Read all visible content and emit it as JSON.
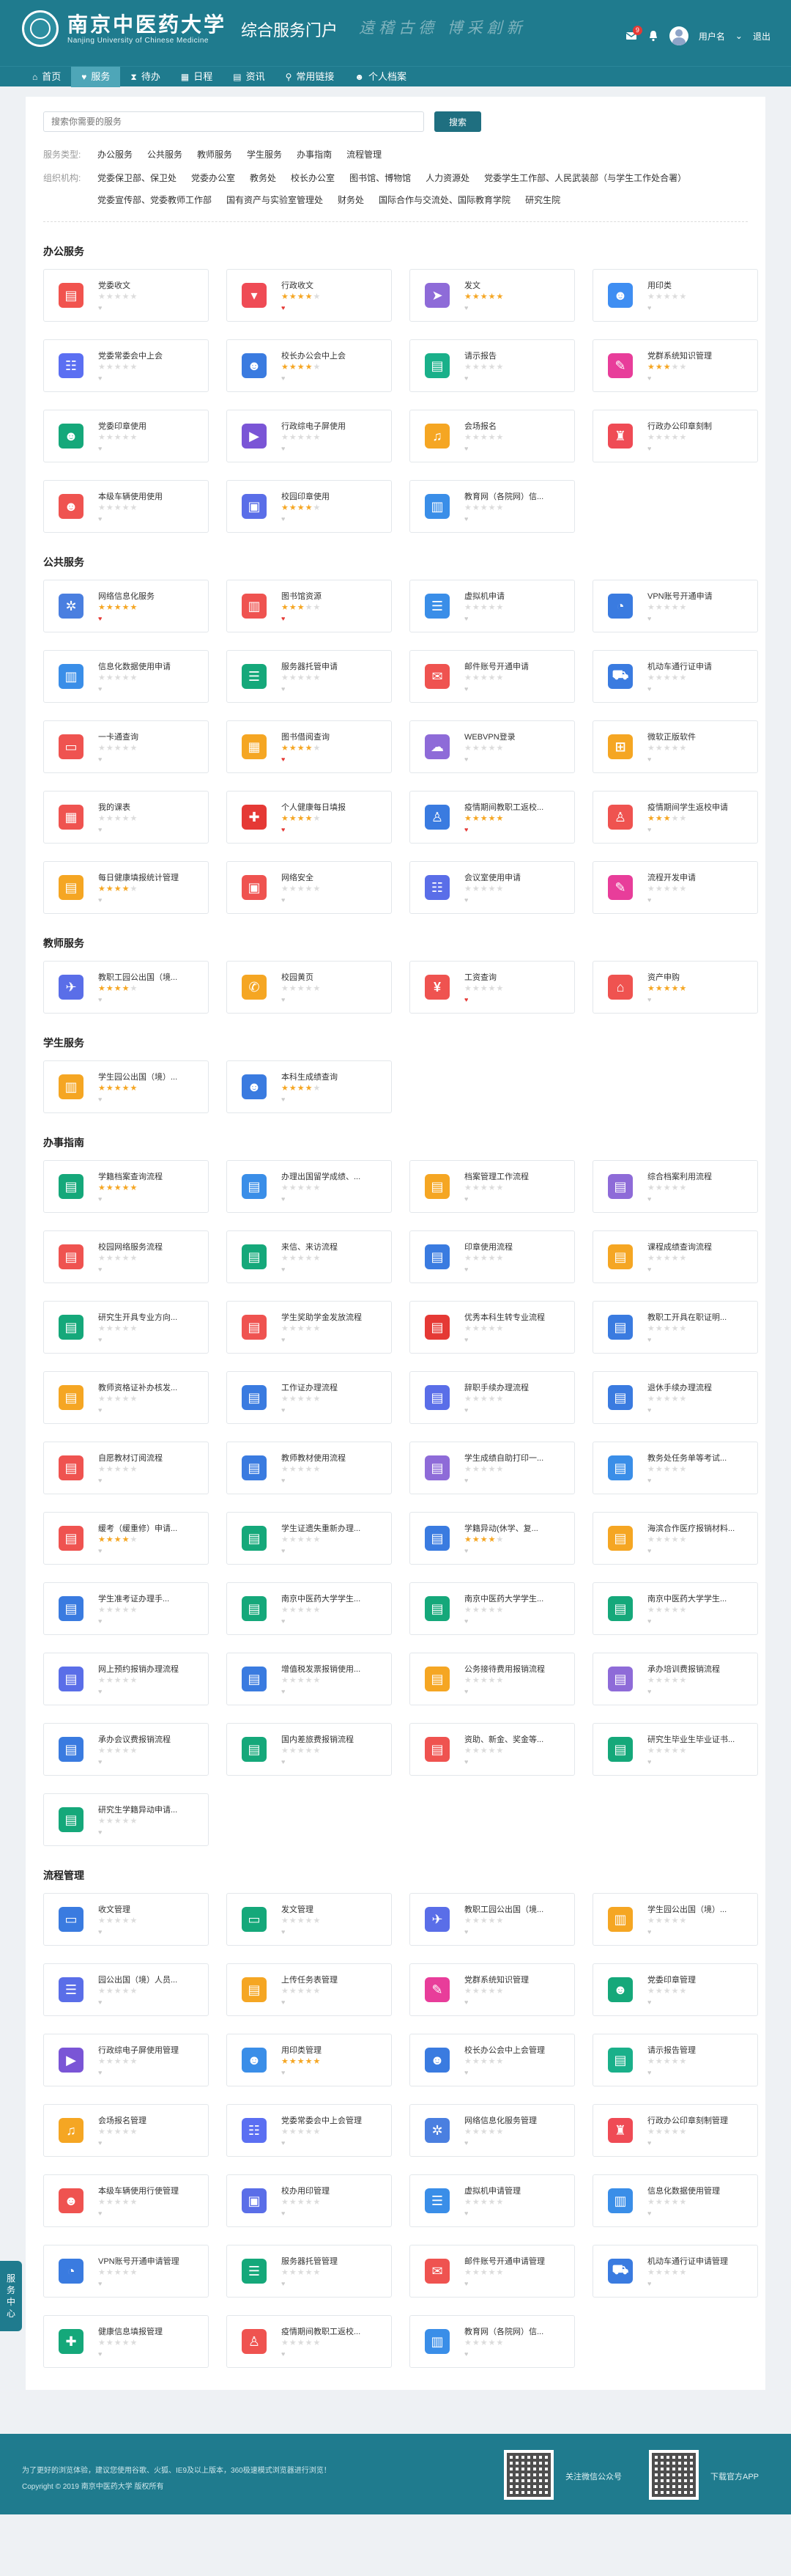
{
  "header": {
    "logo_cn": "南京中医药大学",
    "logo_en": "Nanjing University of Chinese Medicine",
    "portal_title": "综合服务门户",
    "slogan": "遠稽古德 博采創新",
    "user_name": "用户名",
    "logout": "退出",
    "message_badge": "9"
  },
  "nav": [
    "首页",
    "服务",
    "待办",
    "日程",
    "资讯",
    "常用链接",
    "个人档案"
  ],
  "search": {
    "placeholder": "搜索你需要的服务",
    "button": "搜索"
  },
  "filters": {
    "type_label": "服务类型:",
    "types": [
      "办公服务",
      "公共服务",
      "教师服务",
      "学生服务",
      "办事指南",
      "流程管理"
    ],
    "dept_label": "组织机构:",
    "depts": [
      "党委保卫部、保卫处",
      "党委办公室",
      "教务处",
      "校长办公室",
      "图书馆、博物馆",
      "人力资源处",
      "党委学生工作部、人民武装部（与学生工作处合署）",
      "党委宣传部、党委教师工作部",
      "国有资产与实验室管理处",
      "财务处",
      "国际合作与交流处、国际教育学院",
      "研究生院"
    ]
  },
  "sections": [
    {
      "title": "办公服务",
      "items": [
        {
          "name": "党委收文",
          "stars": 0,
          "fav": 0,
          "icon": "doc-icon",
          "color": "#f1534e"
        },
        {
          "name": "行政收文",
          "stars": 4,
          "fav": 1,
          "icon": "inbox-icon",
          "color": "#ef4b55"
        },
        {
          "name": "发文",
          "stars": 5,
          "fav": 0,
          "icon": "send-icon",
          "color": "#8e6bd8"
        },
        {
          "name": "用印类",
          "stars": 0,
          "fav": 0,
          "icon": "user-icon",
          "color": "#3f8ef2"
        },
        {
          "name": "党委常委会中上会",
          "stars": 0,
          "fav": 0,
          "icon": "meeting-icon",
          "color": "#5b6ff2"
        },
        {
          "name": "校长办公会中上会",
          "stars": 4,
          "fav": 0,
          "icon": "person-icon",
          "color": "#3a7be0"
        },
        {
          "name": "请示报告",
          "stars": 0,
          "fav": 0,
          "icon": "report-icon",
          "color": "#1ab08a"
        },
        {
          "name": "党群系统知识管理",
          "stars": 3,
          "fav": 0,
          "icon": "knowledge-icon",
          "color": "#e83d9a"
        },
        {
          "name": "党委印章使用",
          "stars": 0,
          "fav": 0,
          "icon": "seal-icon",
          "color": "#15a87a"
        },
        {
          "name": "行政综电子屏使用",
          "stars": 0,
          "fav": 0,
          "icon": "screen-icon",
          "color": "#7a55d6"
        },
        {
          "name": "会场报名",
          "stars": 0,
          "fav": 0,
          "icon": "bell-icon",
          "color": "#f5a623"
        },
        {
          "name": "行政办公印章刻制",
          "stars": 0,
          "fav": 0,
          "icon": "stamp-icon",
          "color": "#ef4b55"
        },
        {
          "name": "本级车辆使用使用",
          "stars": 0,
          "fav": 0,
          "icon": "car-icon",
          "color": "#ef5350"
        },
        {
          "name": "校园印章使用",
          "stars": 4,
          "fav": 0,
          "icon": "profile-icon",
          "color": "#5a6ee8"
        },
        {
          "name": "教育网（各院网）信...",
          "stars": 0,
          "fav": 0,
          "icon": "chart-icon",
          "color": "#3a8ee8"
        }
      ]
    },
    {
      "title": "公共服务",
      "items": [
        {
          "name": "网络信息化服务",
          "stars": 5,
          "fav": 1,
          "icon": "gear-icon",
          "color": "#4a7fe0"
        },
        {
          "name": "图书馆资源",
          "stars": 3,
          "fav": 1,
          "icon": "book-icon",
          "color": "#ef5350"
        },
        {
          "name": "虚拟机申请",
          "stars": 0,
          "fav": 0,
          "icon": "server-icon",
          "color": "#3a8ee8"
        },
        {
          "name": "VPN账号开通申请",
          "stars": 0,
          "fav": 0,
          "icon": "vpn-icon",
          "color": "#3a7be0"
        },
        {
          "name": "信息化数据使用申请",
          "stars": 0,
          "fav": 0,
          "icon": "data-icon",
          "color": "#3a8ee8"
        },
        {
          "name": "服务器托管申请",
          "stars": 0,
          "fav": 0,
          "icon": "rack-icon",
          "color": "#15a87a"
        },
        {
          "name": "邮件账号开通申请",
          "stars": 0,
          "fav": 0,
          "icon": "mail-icon",
          "color": "#ef5350"
        },
        {
          "name": "机动车通行证申请",
          "stars": 0,
          "fav": 0,
          "icon": "vehicle-icon",
          "color": "#3a7be0"
        },
        {
          "name": "一卡通查询",
          "stars": 0,
          "fav": 0,
          "icon": "card-icon",
          "color": "#ef5350"
        },
        {
          "name": "图书借阅查询",
          "stars": 4,
          "fav": 1,
          "icon": "library-icon",
          "color": "#f5a623"
        },
        {
          "name": "WEBVPN登录",
          "stars": 0,
          "fav": 0,
          "icon": "cloud-icon",
          "color": "#8e6bd8"
        },
        {
          "name": "微软正版软件",
          "stars": 0,
          "fav": 0,
          "icon": "windows-icon",
          "color": "#f5a623"
        },
        {
          "name": "我的课表",
          "stars": 0,
          "fav": 0,
          "icon": "calendar-icon",
          "color": "#ef5350"
        },
        {
          "name": "个人健康每日填报",
          "stars": 4,
          "fav": 1,
          "icon": "health-icon",
          "color": "#e53935"
        },
        {
          "name": "疫情期间教职工返校...",
          "stars": 5,
          "fav": 1,
          "icon": "walk-icon",
          "color": "#3a7be0"
        },
        {
          "name": "疫情期间学生返校申请",
          "stars": 3,
          "fav": 0,
          "icon": "run-icon",
          "color": "#ef5350"
        },
        {
          "name": "每日健康填报统计管理",
          "stars": 4,
          "fav": 0,
          "icon": "stats-icon",
          "color": "#f5a623"
        },
        {
          "name": "网络安全",
          "stars": 0,
          "fav": 0,
          "icon": "security-icon",
          "color": "#ef5350"
        },
        {
          "name": "会议室使用申请",
          "stars": 0,
          "fav": 0,
          "icon": "room-icon",
          "color": "#5a6ee8"
        },
        {
          "name": "流程开发申请",
          "stars": 0,
          "fav": 0,
          "icon": "flow-icon",
          "color": "#e83d9a"
        }
      ]
    },
    {
      "title": "教师服务",
      "items": [
        {
          "name": "教职工园公出国（境...",
          "stars": 4,
          "fav": 0,
          "icon": "plane-icon",
          "color": "#5a6ee8"
        },
        {
          "name": "校园黄页",
          "stars": 0,
          "fav": 0,
          "icon": "phone-icon",
          "color": "#f5a623"
        },
        {
          "name": "工资查询",
          "stars": 0,
          "fav": 1,
          "icon": "salary-icon",
          "color": "#ef5350"
        },
        {
          "name": "资产申购",
          "stars": 5,
          "fav": 0,
          "icon": "house-icon",
          "color": "#ef5350"
        }
      ]
    },
    {
      "title": "学生服务",
      "items": [
        {
          "name": "学生园公出国（境）...",
          "stars": 5,
          "fav": 0,
          "icon": "open-book-icon",
          "color": "#f5a623"
        },
        {
          "name": "本科生成绩查询",
          "stars": 4,
          "fav": 0,
          "icon": "student-icon",
          "color": "#3a7be0"
        }
      ]
    },
    {
      "title": "办事指南",
      "items": [
        {
          "name": "学籍档案查询流程",
          "stars": 5,
          "fav": 0,
          "icon": "guide-icon",
          "color": "#15a87a"
        },
        {
          "name": "办理出国留学成绩、...",
          "stars": 0,
          "fav": 0,
          "icon": "guide-icon",
          "color": "#3a8ee8"
        },
        {
          "name": "档案管理工作流程",
          "stars": 0,
          "fav": 0,
          "icon": "guide-icon",
          "color": "#f5a623"
        },
        {
          "name": "综合档案利用流程",
          "stars": 0,
          "fav": 0,
          "icon": "guide-icon",
          "color": "#8e6bd8"
        },
        {
          "name": "校园网络服务流程",
          "stars": 0,
          "fav": 0,
          "icon": "guide-icon",
          "color": "#ef5350"
        },
        {
          "name": "来信、来访流程",
          "stars": 0,
          "fav": 0,
          "icon": "guide-icon",
          "color": "#15a87a"
        },
        {
          "name": "印章使用流程",
          "stars": 0,
          "fav": 0,
          "icon": "guide-icon",
          "color": "#3a7be0"
        },
        {
          "name": "课程成绩查询流程",
          "stars": 0,
          "fav": 0,
          "icon": "guide-icon",
          "color": "#f5a623"
        },
        {
          "name": "研究生开具专业方向...",
          "stars": 0,
          "fav": 0,
          "icon": "guide-icon",
          "color": "#15a87a"
        },
        {
          "name": "学生奖助学金发放流程",
          "stars": 0,
          "fav": 0,
          "icon": "guide-icon",
          "color": "#ef5350"
        },
        {
          "name": "优秀本科生转专业流程",
          "stars": 0,
          "fav": 0,
          "icon": "guide-icon",
          "color": "#e53935"
        },
        {
          "name": "教职工开具在职证明...",
          "stars": 0,
          "fav": 0,
          "icon": "guide-icon",
          "color": "#3a7be0"
        },
        {
          "name": "教师资格证补办核发...",
          "stars": 0,
          "fav": 0,
          "icon": "guide-icon",
          "color": "#f5a623"
        },
        {
          "name": "工作证办理流程",
          "stars": 0,
          "fav": 0,
          "icon": "guide-icon",
          "color": "#3a7be0"
        },
        {
          "name": "辞职手续办理流程",
          "stars": 0,
          "fav": 0,
          "icon": "guide-icon",
          "color": "#5a6ee8"
        },
        {
          "name": "退休手续办理流程",
          "stars": 0,
          "fav": 0,
          "icon": "guide-icon",
          "color": "#3a7be0"
        },
        {
          "name": "自愿教材订阅流程",
          "stars": 0,
          "fav": 0,
          "icon": "guide-icon",
          "color": "#ef5350"
        },
        {
          "name": "教师教材使用流程",
          "stars": 0,
          "fav": 0,
          "icon": "guide-icon",
          "color": "#3a7be0"
        },
        {
          "name": "学生成绩自助打印一...",
          "stars": 0,
          "fav": 0,
          "icon": "guide-icon",
          "color": "#8e6bd8"
        },
        {
          "name": "教务处任务单等考试...",
          "stars": 0,
          "fav": 0,
          "icon": "guide-icon",
          "color": "#3a8ee8"
        },
        {
          "name": "缓考（缓重修）申请...",
          "stars": 4,
          "fav": 0,
          "icon": "guide-icon",
          "color": "#ef5350"
        },
        {
          "name": "学生证遗失重新办理...",
          "stars": 0,
          "fav": 0,
          "icon": "guide-icon",
          "color": "#15a87a"
        },
        {
          "name": "学籍异动(休学、复...",
          "stars": 4,
          "fav": 0,
          "icon": "guide-icon",
          "color": "#3a7be0"
        },
        {
          "name": "海滨合作医疗报销材料...",
          "stars": 0,
          "fav": 0,
          "icon": "guide-icon",
          "color": "#f5a623"
        },
        {
          "name": "学生准考证办理手...",
          "stars": 0,
          "fav": 0,
          "icon": "guide-icon",
          "color": "#3a7be0"
        },
        {
          "name": "南京中医药大学学生...",
          "stars": 0,
          "fav": 0,
          "icon": "guide-icon",
          "color": "#15a87a"
        },
        {
          "name": "南京中医药大学学生...",
          "stars": 0,
          "fav": 0,
          "icon": "guide-icon",
          "color": "#15a87a"
        },
        {
          "name": "南京中医药大学学生...",
          "stars": 0,
          "fav": 0,
          "icon": "guide-icon",
          "color": "#15a87a"
        },
        {
          "name": "网上预约报销办理流程",
          "stars": 0,
          "fav": 0,
          "icon": "guide-icon",
          "color": "#5a6ee8"
        },
        {
          "name": "增值税发票报销使用...",
          "stars": 0,
          "fav": 0,
          "icon": "guide-icon",
          "color": "#3a7be0"
        },
        {
          "name": "公务接待费用报销流程",
          "stars": 0,
          "fav": 0,
          "icon": "guide-icon",
          "color": "#f5a623"
        },
        {
          "name": "承办培训费报销流程",
          "stars": 0,
          "fav": 0,
          "icon": "guide-icon",
          "color": "#8e6bd8"
        },
        {
          "name": "承办会议费报销流程",
          "stars": 0,
          "fav": 0,
          "icon": "guide-icon",
          "color": "#3a7be0"
        },
        {
          "name": "国内差旅费报销流程",
          "stars": 0,
          "fav": 0,
          "icon": "guide-icon",
          "color": "#15a87a"
        },
        {
          "name": "资助、新金、奖金等...",
          "stars": 0,
          "fav": 0,
          "icon": "guide-icon",
          "color": "#ef5350"
        },
        {
          "name": "研究生毕业生毕业证书...",
          "stars": 0,
          "fav": 0,
          "icon": "guide-icon",
          "color": "#15a87a"
        },
        {
          "name": "研究生学籍异动申请...",
          "stars": 0,
          "fav": 0,
          "icon": "guide-icon",
          "color": "#15a87a"
        }
      ]
    },
    {
      "title": "流程管理",
      "items": [
        {
          "name": "收文管理",
          "stars": 0,
          "fav": 0,
          "icon": "folder-icon",
          "color": "#3a7be0"
        },
        {
          "name": "发文管理",
          "stars": 0,
          "fav": 0,
          "icon": "folder-open-icon",
          "color": "#15a87a"
        },
        {
          "name": "教职工园公出国（境...",
          "stars": 0,
          "fav": 0,
          "icon": "plane-icon",
          "color": "#5a6ee8"
        },
        {
          "name": "学生园公出国（境）...",
          "stars": 0,
          "fav": 0,
          "icon": "open-book-icon",
          "color": "#f5a623"
        },
        {
          "name": "园公出国（境）人员...",
          "stars": 0,
          "fav": 0,
          "icon": "list-icon",
          "color": "#5a6ee8"
        },
        {
          "name": "上传任务表管理",
          "stars": 0,
          "fav": 0,
          "icon": "task-icon",
          "color": "#f5a623"
        },
        {
          "name": "党群系统知识管理",
          "stars": 0,
          "fav": 0,
          "icon": "knowledge-icon",
          "color": "#e83d9a"
        },
        {
          "name": "党委印章管理",
          "stars": 0,
          "fav": 0,
          "icon": "seal-icon",
          "color": "#15a87a"
        },
        {
          "name": "行政综电子屏使用管理",
          "stars": 0,
          "fav": 0,
          "icon": "screen-icon",
          "color": "#7a55d6"
        },
        {
          "name": "用印类管理",
          "stars": 5,
          "fav": 0,
          "icon": "user-icon",
          "color": "#3a8ee8"
        },
        {
          "name": "校长办公会中上会管理",
          "stars": 0,
          "fav": 0,
          "icon": "person-icon",
          "color": "#3a7be0"
        },
        {
          "name": "请示报告管理",
          "stars": 0,
          "fav": 0,
          "icon": "report-icon",
          "color": "#1ab08a"
        },
        {
          "name": "会场报名管理",
          "stars": 0,
          "fav": 0,
          "icon": "bell-icon",
          "color": "#f5a623"
        },
        {
          "name": "党委常委会中上会管理",
          "stars": 0,
          "fav": 0,
          "icon": "meeting-icon",
          "color": "#5b6ff2"
        },
        {
          "name": "网络信息化服务管理",
          "stars": 0,
          "fav": 0,
          "icon": "gear-icon",
          "color": "#4a7fe0"
        },
        {
          "name": "行政办公印章刻制管理",
          "stars": 0,
          "fav": 0,
          "icon": "stamp-icon",
          "color": "#ef4b55"
        },
        {
          "name": "本级车辆使用行使管理",
          "stars": 0,
          "fav": 0,
          "icon": "car-icon",
          "color": "#ef5350"
        },
        {
          "name": "校办用印管理",
          "stars": 0,
          "fav": 0,
          "icon": "profile-icon",
          "color": "#5a6ee8"
        },
        {
          "name": "虚拟机申请管理",
          "stars": 0,
          "fav": 0,
          "icon": "server-icon",
          "color": "#3a8ee8"
        },
        {
          "name": "信息化数据使用管理",
          "stars": 0,
          "fav": 0,
          "icon": "data-icon",
          "color": "#3a8ee8"
        },
        {
          "name": "VPN账号开通申请管理",
          "stars": 0,
          "fav": 0,
          "icon": "vpn-icon",
          "color": "#3a7be0"
        },
        {
          "name": "服务器托管管理",
          "stars": 0,
          "fav": 0,
          "icon": "rack-icon",
          "color": "#15a87a"
        },
        {
          "name": "邮件账号开通申请管理",
          "stars": 0,
          "fav": 0,
          "icon": "mail-icon",
          "color": "#ef5350"
        },
        {
          "name": "机动车通行证申请管理",
          "stars": 0,
          "fav": 0,
          "icon": "vehicle-icon",
          "color": "#3a7be0"
        },
        {
          "name": "健康信息填报管理",
          "stars": 0,
          "fav": 0,
          "icon": "health-report-icon",
          "color": "#15a87a"
        },
        {
          "name": "疫情期间教职工返校...",
          "stars": 0,
          "fav": 0,
          "icon": "walk-icon",
          "color": "#ef5350"
        },
        {
          "name": "教育网（各院网）信...",
          "stars": 0,
          "fav": 0,
          "icon": "chart-icon",
          "color": "#3a8ee8"
        }
      ]
    }
  ],
  "sidebar_tab": "服务中心",
  "footer": {
    "line1": "为了更好的浏览体验，建议您使用谷歌、火狐、IE9及以上版本，360极速模式浏览器进行浏览！",
    "line2": "Copyright © 2019 南京中医药大学 版权所有",
    "qr1_label": "关注微信公众号",
    "qr2_label": "下载官方APP"
  }
}
